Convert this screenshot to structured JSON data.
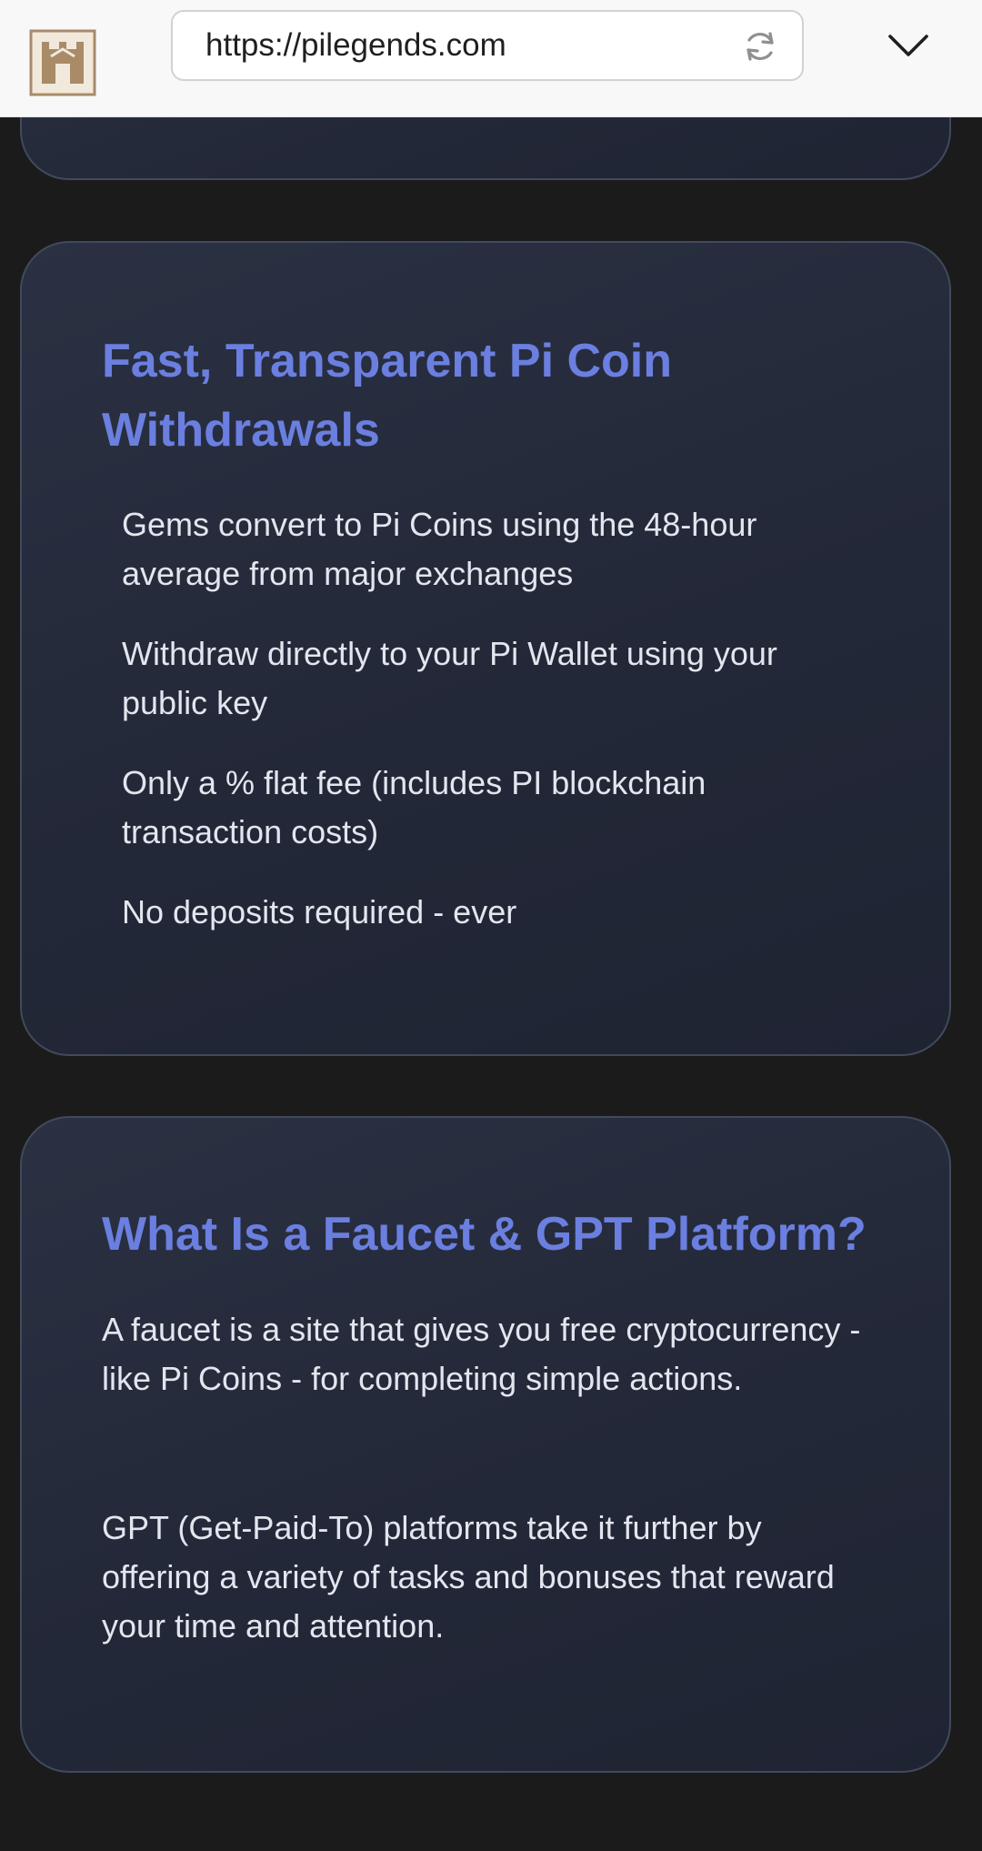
{
  "browser": {
    "url": "https://pilegends.com"
  },
  "sections": [
    {
      "title": "Fast, Transparent Pi Coin Withdrawals",
      "items": [
        "Gems convert to Pi Coins using the 48-hour average from major exchanges",
        "Withdraw directly to your Pi Wallet using your public key",
        "Only a % flat fee (includes PI blockchain transaction costs)",
        "No deposits required - ever"
      ]
    },
    {
      "title": "What Is a Faucet & GPT Platform?",
      "paragraphs": [
        "A faucet is a site that gives you free cryptocurrency - like Pi Coins - for completing simple actions.",
        "GPT (Get-Paid-To) platforms take it further by offering a variety of tasks and bonuses that reward your time and attention."
      ]
    }
  ],
  "colors": {
    "page_background": "#1b1b1c",
    "card_background": "#262c3c",
    "heading": "#6b7fe0",
    "body_text": "#e3e6ee"
  },
  "icons": [
    "site-logo-icon",
    "reload-icon",
    "chevron-down-icon"
  ]
}
